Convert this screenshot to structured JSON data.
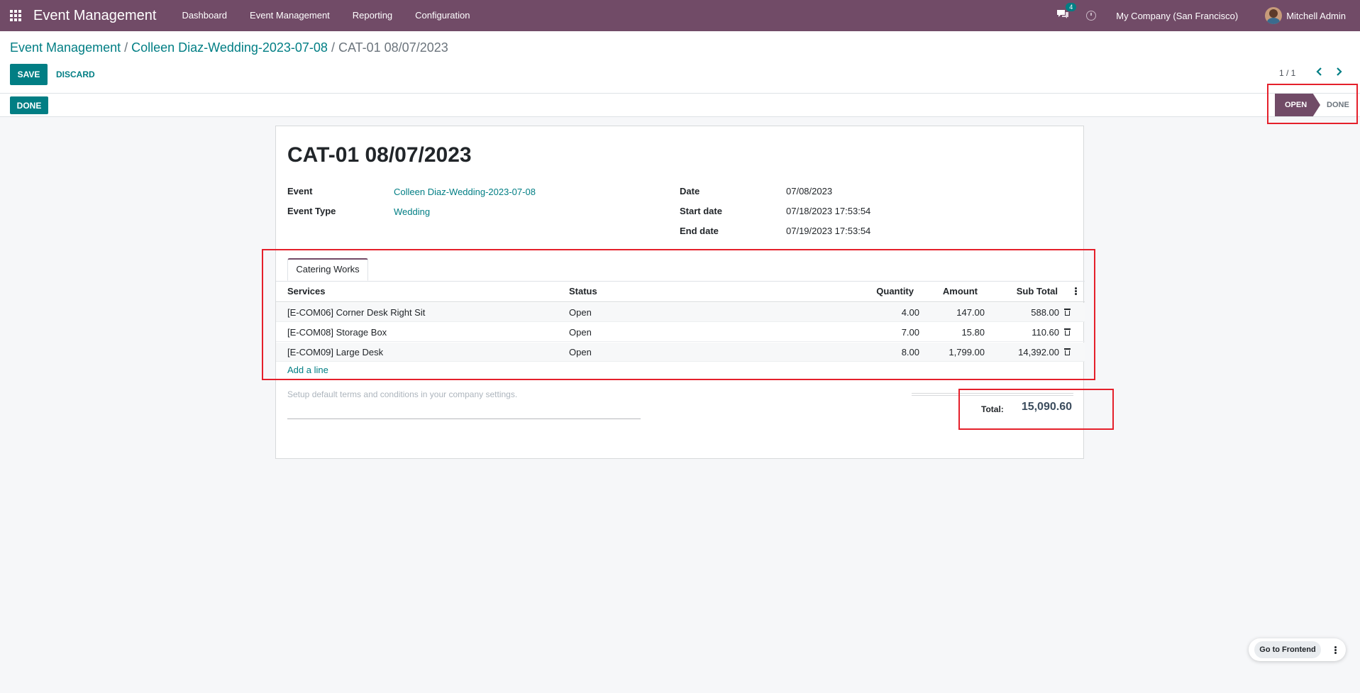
{
  "navbar": {
    "brand": "Event Management",
    "menu": [
      "Dashboard",
      "Event Management",
      "Reporting",
      "Configuration"
    ],
    "chat_badge": "4",
    "company": "My Company (San Francisco)",
    "user": "Mitchell Admin",
    "icons": [
      "apps-grid-icon",
      "chat-icon",
      "clock-icon",
      "avatar"
    ]
  },
  "breadcrumb": {
    "items": [
      "Event Management",
      "Colleen Diaz-Wedding-2023-07-08"
    ],
    "separator": "/",
    "current": "CAT-01 08/07/2023"
  },
  "actions": {
    "save": "Save",
    "discard": "Discard"
  },
  "pager": {
    "text": "1 / 1"
  },
  "statusbar": {
    "done_button": "Done",
    "stages": [
      {
        "label": "OPEN",
        "active": true
      },
      {
        "label": "DONE",
        "active": false
      }
    ]
  },
  "record": {
    "title": "CAT-01 08/07/2023",
    "left_fields": [
      {
        "label": "Event",
        "value": "Colleen Diaz-Wedding-2023-07-08",
        "link": true
      },
      {
        "label": "Event Type",
        "value": "Wedding",
        "link": true
      }
    ],
    "right_fields": [
      {
        "label": "Date",
        "value": "07/08/2023"
      },
      {
        "label": "Start date",
        "value": "07/18/2023 17:53:54"
      },
      {
        "label": "End date",
        "value": "07/19/2023 17:53:54"
      }
    ]
  },
  "tabs": [
    "Catering Works"
  ],
  "table": {
    "columns": [
      "Services",
      "Status",
      "Quantity",
      "Amount",
      "Sub Total"
    ],
    "rows": [
      {
        "service": "[E-COM06] Corner Desk Right Sit",
        "status": "Open",
        "quantity": "4.00",
        "amount": "147.00",
        "subtotal": "588.00"
      },
      {
        "service": "[E-COM08] Storage Box",
        "status": "Open",
        "quantity": "7.00",
        "amount": "15.80",
        "subtotal": "110.60"
      },
      {
        "service": "[E-COM09] Large Desk",
        "status": "Open",
        "quantity": "8.00",
        "amount": "1,799.00",
        "subtotal": "14,392.00"
      }
    ],
    "add_line": "Add a line"
  },
  "terms_placeholder": "Setup default terms and conditions in your company settings.",
  "total": {
    "label": "Total:",
    "value": "15,090.60"
  },
  "frontend": {
    "label": "Go to Frontend"
  },
  "colors": {
    "brand": "#714b67",
    "accent": "#017e84",
    "highlight": "#e5202b"
  }
}
